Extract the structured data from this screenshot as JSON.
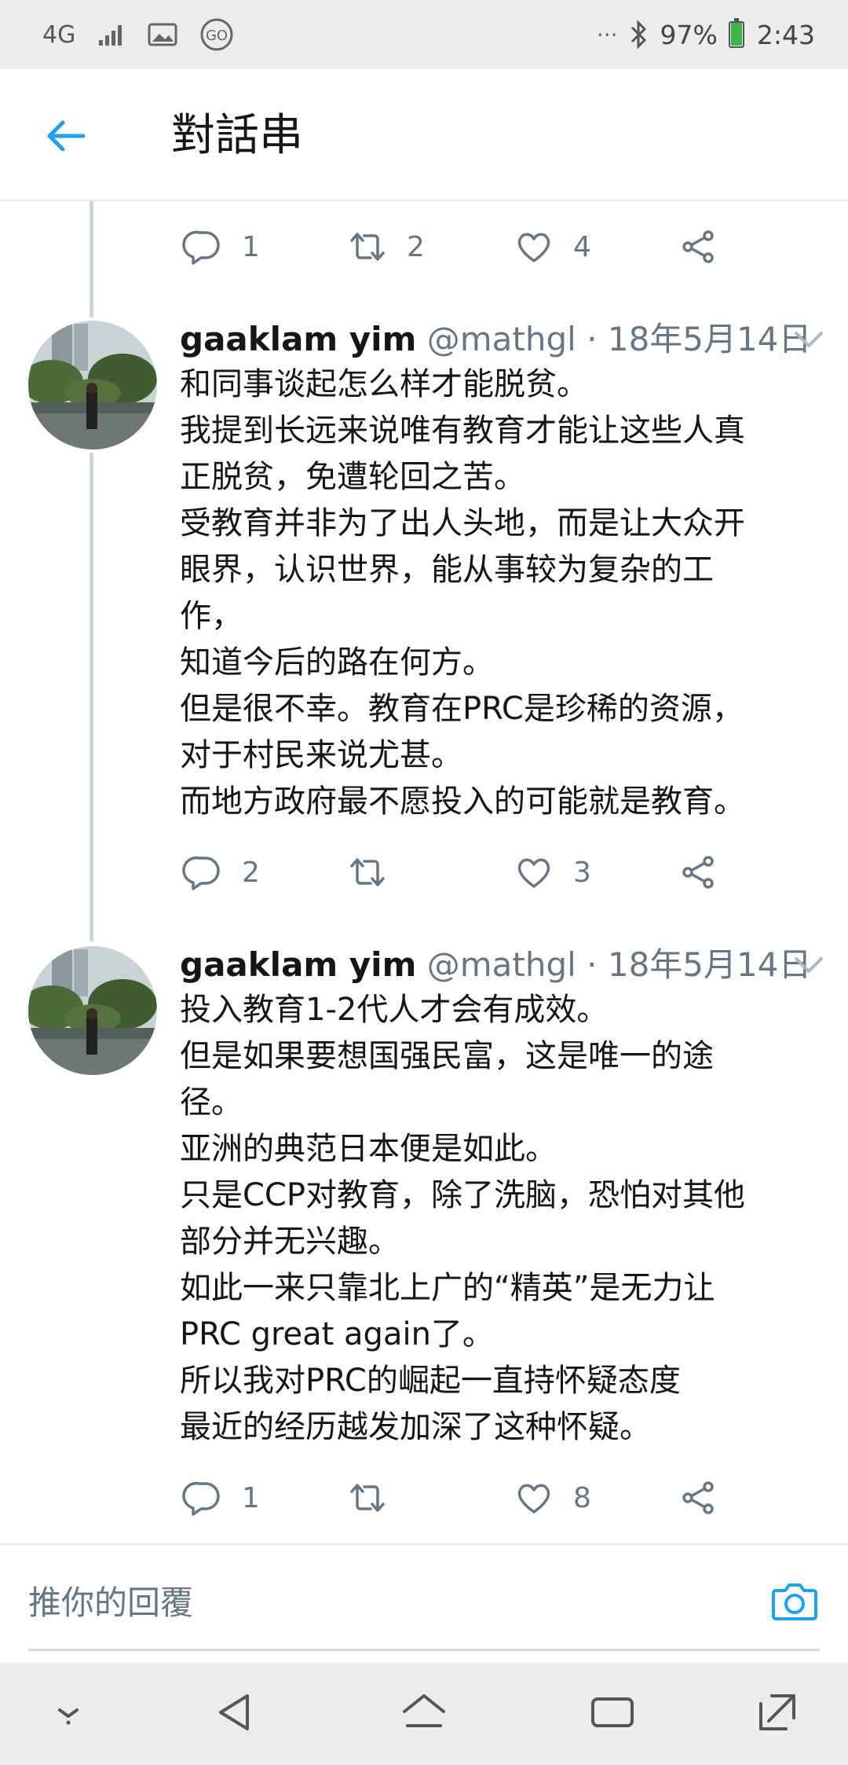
{
  "status_bar": {
    "network": "4G",
    "battery": "97%",
    "battery_level": 0.97,
    "time": "2:43"
  },
  "header": {
    "title": "對話串"
  },
  "top_actions": {
    "replies": "1",
    "retweets": "2",
    "likes": "4"
  },
  "tweets": [
    {
      "name": "gaaklam yim",
      "handle": "@mathgl",
      "date": "· 18年5月14日",
      "lines": [
        "和同事谈起怎么样才能脱贫。",
        "我提到长远来说唯有教育才能让这些人真",
        "正脱贫，免遭轮回之苦。",
        "受教育并非为了出人头地，而是让大众开",
        "眼界，认识世界，能从事较为复杂的工",
        "作，",
        "知道今后的路在何方。",
        "但是很不幸。教育在PRC是珍稀的资源，",
        "对于村民来说尤甚。",
        "而地方政府最不愿投入的可能就是教育。"
      ],
      "replies": "2",
      "retweets": "",
      "likes": "3"
    },
    {
      "name": "gaaklam yim",
      "handle": "@mathgl",
      "date": "· 18年5月14日",
      "lines": [
        "投入教育1-2代人才会有成效。",
        "但是如果要想国强民富，这是唯一的途",
        "径。",
        "亚洲的典范日本便是如此。",
        "只是CCP对教育，除了洗脑，恐怕对其他",
        "部分并无兴趣。",
        "如此一来只靠北上广的“精英”是无力让",
        "PRC great again了。",
        "所以我对PRC的崛起一直持怀疑态度",
        "最近的经历越发加深了这种怀疑。"
      ],
      "replies": "1",
      "retweets": "",
      "likes": "8"
    }
  ],
  "reply_bar": {
    "placeholder": "推你的回覆"
  },
  "colors": {
    "accent": "#1da1f2",
    "icon_gray": "#657786",
    "thread_line": "#ccd6dd",
    "system_bar": "#ececec"
  }
}
